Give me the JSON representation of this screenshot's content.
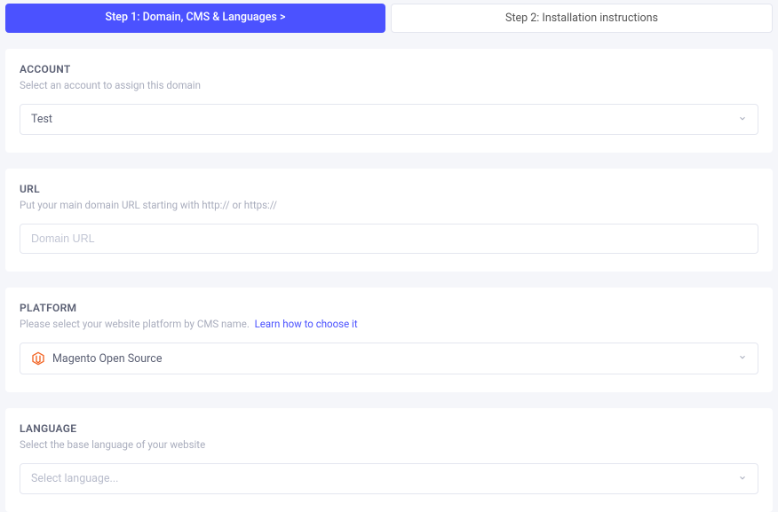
{
  "steps": {
    "active": "Step 1: Domain, CMS & Languages  >",
    "inactive": "Step 2: Installation instructions"
  },
  "account": {
    "title": "ACCOUNT",
    "sub": "Select an account to assign this domain",
    "value": "Test"
  },
  "url": {
    "title": "URL",
    "sub": "Put your main domain URL starting with http:// or https://",
    "placeholder": "Domain URL"
  },
  "platform": {
    "title": "PLATFORM",
    "sub_text": "Please select your website platform by CMS name.",
    "link_text": "Learn how to choose it",
    "value": "Magento Open Source"
  },
  "language": {
    "title": "LANGUAGE",
    "sub": "Select the base language of your website",
    "placeholder": "Select language..."
  }
}
